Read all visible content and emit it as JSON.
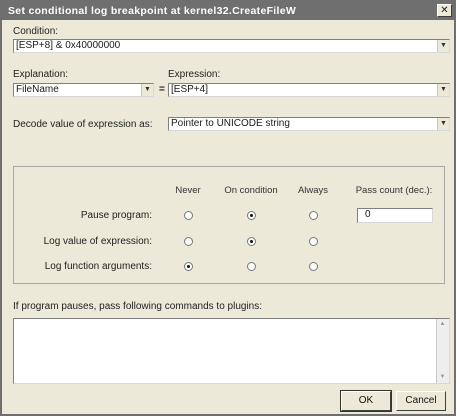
{
  "dialog": {
    "title": "Set conditional log breakpoint at kernel32.CreateFileW",
    "close_glyph": "✕"
  },
  "condition": {
    "label": "Condition:",
    "value": "[ESP+8] & 0x40000000"
  },
  "explanation": {
    "label": "Explanation:",
    "value": "FileName"
  },
  "equals_sign": "=",
  "expression": {
    "label": "Expression:",
    "value": "[ESP+4]"
  },
  "decode": {
    "label": "Decode value of expression as:",
    "value": "Pointer to UNICODE string"
  },
  "options": {
    "columns": [
      "Never",
      "On condition",
      "Always"
    ],
    "pass_count_label": "Pass count (dec.):",
    "pass_count_value": "0",
    "rows": [
      {
        "label": "Pause program:",
        "selected": 1
      },
      {
        "label": "Log value of expression:",
        "selected": 1
      },
      {
        "label": "Log function arguments:",
        "selected": 0
      }
    ]
  },
  "commands": {
    "label": "If program pauses, pass following commands to plugins:",
    "value": ""
  },
  "buttons": {
    "ok": "OK",
    "cancel": "Cancel"
  }
}
